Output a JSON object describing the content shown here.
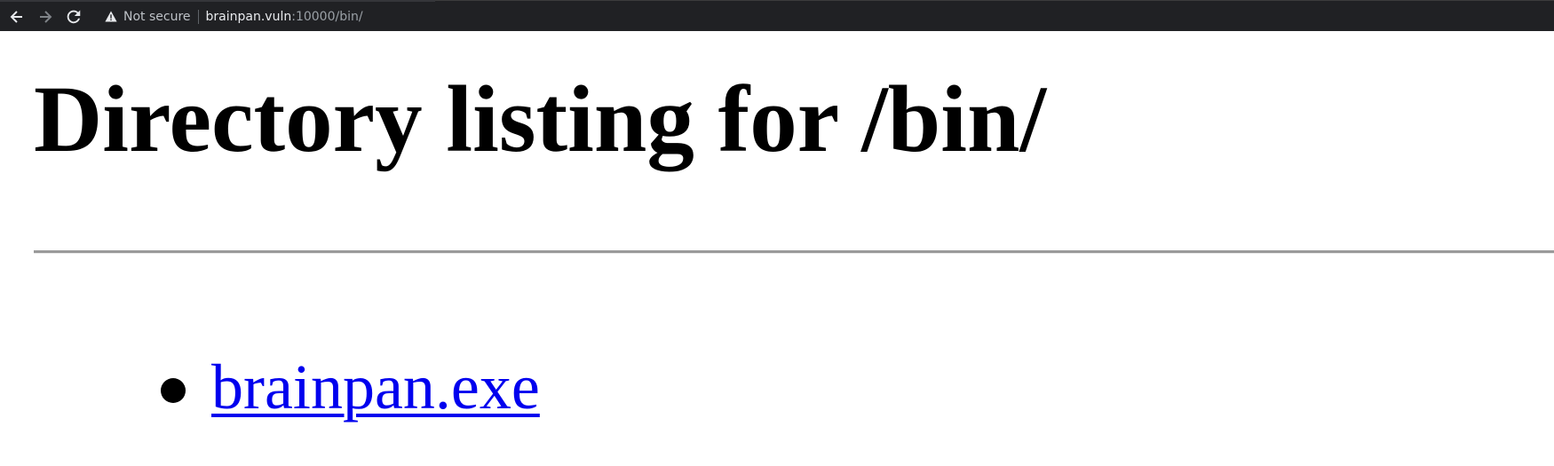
{
  "browser": {
    "security_label": "Not secure",
    "url_host": "brainpan.vuln",
    "url_rest": ":10000/bin/",
    "icons": {
      "back": "arrow-left-icon",
      "forward": "arrow-right-icon",
      "reload": "reload-icon",
      "security": "warning-triangle-icon"
    },
    "colors": {
      "toolbar_bg": "#202124",
      "host_text": "#e8eaed",
      "path_text": "#9aa0a6"
    }
  },
  "page": {
    "heading": "Directory listing for /bin/",
    "files": [
      {
        "name": "brainpan.exe"
      }
    ],
    "colors": {
      "link": "#0000ee",
      "text": "#000000"
    }
  }
}
